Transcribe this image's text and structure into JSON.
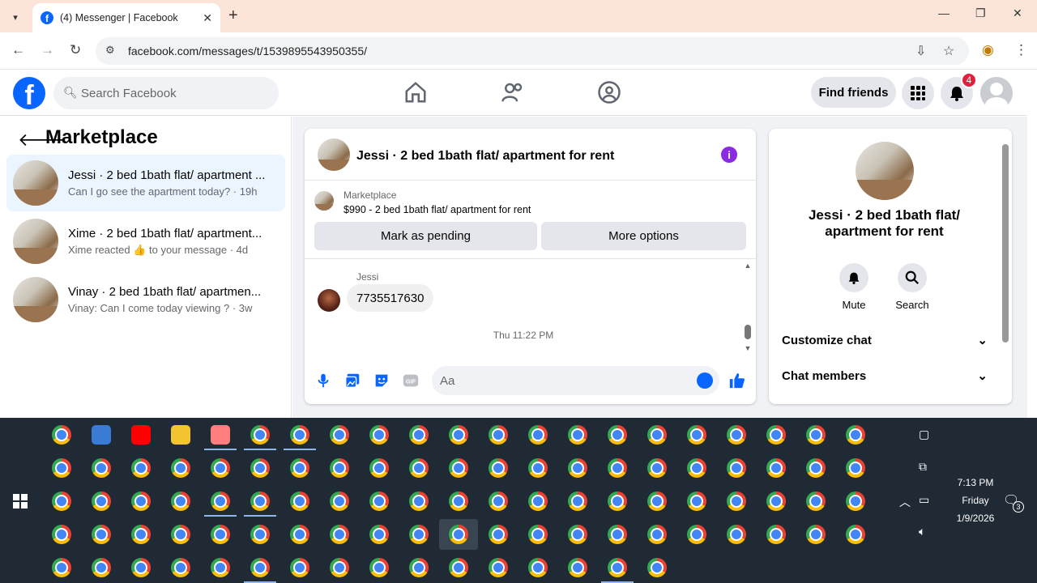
{
  "browser": {
    "tab_title": "(4) Messenger | Facebook",
    "url": "facebook.com/messages/t/1539895543950355/"
  },
  "fb": {
    "search_placeholder": "Search Facebook",
    "find_friends": "Find friends",
    "notif_count": "4"
  },
  "left": {
    "title": "Marketplace",
    "conversations": [
      {
        "name": "Jessi · 2 bed 1bath flat/ apartment ...",
        "preview": "Can I go see the apartment today? · 19h"
      },
      {
        "name": "Xime · 2 bed 1bath flat/ apartment...",
        "preview": "Xime reacted 👍 to your message · 4d"
      },
      {
        "name": "Vinay · 2 bed 1bath flat/ apartmen...",
        "preview": "Vinay: Can I come today viewing ? · 3w"
      }
    ]
  },
  "chat": {
    "title": "Jessi · 2 bed 1bath flat/ apartment for rent",
    "listing_source": "Marketplace",
    "listing_price": "$990 - 2 bed 1bath flat/ apartment for rent",
    "btn_pending": "Mark as pending",
    "btn_more": "More options",
    "sender": "Jessi",
    "message": "7735517630",
    "timestamp": "Thu 11:22 PM",
    "composer_placeholder": "Aa"
  },
  "details": {
    "title": "Jessi · 2 bed 1bath flat/ apartment for rent",
    "mute": "Mute",
    "search": "Search",
    "customize": "Customize chat",
    "members": "Chat members"
  },
  "tray": {
    "time": "7:13 PM",
    "day": "Friday",
    "date": "1/9/2026",
    "notif_count": "3"
  }
}
